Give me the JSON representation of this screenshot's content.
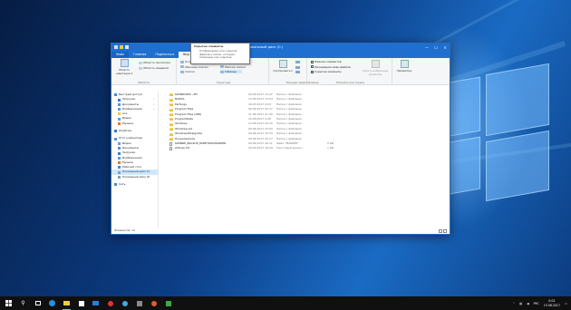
{
  "window": {
    "title": "Локальный диск (C:)",
    "context_tab": "Средства работы с дисками",
    "minimize_glyph": "—",
    "maximize_glyph": "☐",
    "close_glyph": "✕"
  },
  "ribbon_tabs": [
    {
      "label": "Файл"
    },
    {
      "label": "Главная"
    },
    {
      "label": "Поделиться"
    },
    {
      "label": "Вид"
    },
    {
      "label": "Управление"
    }
  ],
  "ribbon": {
    "panes_group": {
      "name": "Области",
      "nav_pane": "Область навигации ▾",
      "preview": "Область просмотра",
      "details": "Область сведений"
    },
    "layout_group": {
      "name": "Структура",
      "items": [
        "Огромные значки",
        "Крупные значки",
        "Обычные значки",
        "Мелкие значки",
        "Список",
        "Таблица"
      ]
    },
    "current_view_group": {
      "name": "Текущее представление",
      "sort": "Сортировать ▾"
    },
    "showhide_group": {
      "name": "Показать или скрыть",
      "checks": [
        {
          "label": "Флажки элементов",
          "checked": false
        },
        {
          "label": "Расширения имен файлов",
          "checked": true
        },
        {
          "label": "Скрытые элементы",
          "checked": true
        }
      ],
      "hide_selected": "Скрыть выбранные элементы"
    },
    "options": "Параметры"
  },
  "nav": [
    {
      "label": "Быстрый доступ",
      "pinned": false,
      "indent": false,
      "selected": false
    },
    {
      "label": "Загрузки",
      "pinned": true,
      "indent": true,
      "selected": false
    },
    {
      "label": "Документы",
      "pinned": true,
      "indent": true,
      "selected": false
    },
    {
      "label": "Изображения",
      "pinned": true,
      "indent": true,
      "selected": false
    },
    {
      "label": "Ace",
      "pinned": false,
      "indent": true,
      "selected": false
    },
    {
      "label": "Видео",
      "pinned": false,
      "indent": true,
      "selected": false
    },
    {
      "label": "Музыка",
      "pinned": false,
      "indent": true,
      "selected": false
    },
    {
      "label": "OneDrive",
      "pinned": false,
      "indent": false,
      "selected": false
    },
    {
      "label": "Этот компьютер",
      "pinned": false,
      "indent": false,
      "selected": false
    },
    {
      "label": "Видео",
      "pinned": false,
      "indent": true,
      "selected": false
    },
    {
      "label": "Документы",
      "pinned": false,
      "indent": true,
      "selected": false
    },
    {
      "label": "Загрузки",
      "pinned": false,
      "indent": true,
      "selected": false
    },
    {
      "label": "Изображения",
      "pinned": false,
      "indent": true,
      "selected": false
    },
    {
      "label": "Музыка",
      "pinned": false,
      "indent": true,
      "selected": false
    },
    {
      "label": "Рабочий стол",
      "pinned": false,
      "indent": true,
      "selected": false
    },
    {
      "label": "Локальный диск (C",
      "pinned": false,
      "indent": true,
      "selected": true
    },
    {
      "label": "Локальный диск (E",
      "pinned": false,
      "indent": true,
      "selected": false
    },
    {
      "label": "Сеть",
      "pinned": false,
      "indent": false,
      "selected": false
    }
  ],
  "pin_glyph": "✓",
  "files": [
    {
      "name": "$WINDOWS.~BT",
      "date": "09.06.2017 14:47",
      "type": "Папка с файлами",
      "size": "",
      "kind": "folder"
    },
    {
      "name": "NVIDIA",
      "date": "13.06.2017 13:54",
      "type": "Папка с файлами",
      "size": "",
      "kind": "folder"
    },
    {
      "name": "PerfLogs",
      "date": "18.03.2017 0:03",
      "type": "Папка с файлами",
      "size": "",
      "kind": "folder"
    },
    {
      "name": "Program Files",
      "date": "09.06.2017 22:17",
      "type": "Папка с файлами",
      "size": "",
      "kind": "folder"
    },
    {
      "name": "Program Files (x86)",
      "date": "11.06.2017 21:39",
      "type": "Папка с файлами",
      "size": "",
      "kind": "folder"
    },
    {
      "name": "ProgramData",
      "date": "10.06.2017 0:46",
      "type": "Папка с файлами",
      "size": "",
      "kind": "folder"
    },
    {
      "name": "Windows",
      "date": "13.06.2017 23:19",
      "type": "Папка с файлами",
      "size": "",
      "kind": "folder"
    },
    {
      "name": "Windows.old",
      "date": "09.06.2017 23:03",
      "type": "Папка с файлами",
      "size": "",
      "kind": "folder"
    },
    {
      "name": "Windows10Upgrade",
      "date": "09.06.2017 15:33",
      "type": "Папка с файлами",
      "size": "",
      "kind": "folder"
    },
    {
      "name": "Пользователи",
      "date": "09.06.2017 22:17",
      "type": "Папка с файлами",
      "size": "",
      "kind": "folder"
    },
    {
      "name": "$WINRE_BACKUP_PARTITION.MARKER",
      "date": "09.06.2017 20:11",
      "type": "Файл \"MARKER\"",
      "size": "0 КБ",
      "kind": "file"
    },
    {
      "name": "AVScan.txt",
      "date": "09.06.2017 18:44",
      "type": "Текстовый докум...",
      "size": "1 КБ",
      "kind": "file"
    }
  ],
  "tooltip": {
    "title": "Скрытые элементы",
    "description": "Отображение или скрытие файлов и папок, которые помечены как скрытые."
  },
  "status": {
    "count": "Элементов: 12"
  },
  "taskbar": {
    "search_glyph": "⚲",
    "language": "РУС",
    "time": "0:02",
    "date": "15.06.2017"
  },
  "colors": {
    "accent": "#1e6fd0",
    "context_tab": "#f6d34a",
    "selection": "#cde8ff"
  }
}
